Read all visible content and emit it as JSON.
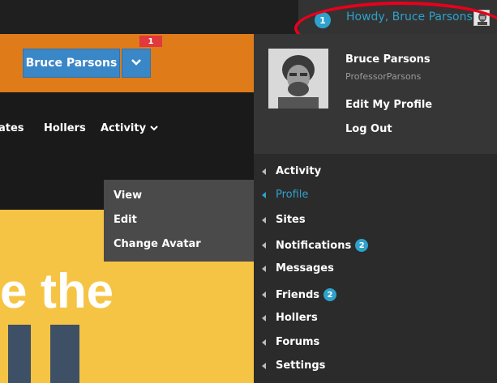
{
  "adminbar": {
    "count": "1",
    "howdy": "Howdy, Bruce Parsons"
  },
  "header": {
    "user_button": "Bruce Parsons",
    "notification_count": "1"
  },
  "nav": {
    "items": [
      "ates",
      "Hollers",
      "Activity"
    ]
  },
  "submenu": {
    "items": [
      "View",
      "Edit",
      "Change Avatar"
    ]
  },
  "hero": {
    "text": "e the"
  },
  "account": {
    "name": "Bruce Parsons",
    "username": "ProfessorParsons",
    "edit_profile": "Edit My Profile",
    "logout": "Log Out"
  },
  "menu": {
    "items": [
      {
        "label": "Activity"
      },
      {
        "label": "Profile"
      },
      {
        "label": "Sites"
      },
      {
        "label": "Notifications",
        "badge": "2"
      },
      {
        "label": "Messages"
      },
      {
        "label": "Friends",
        "badge": "2"
      },
      {
        "label": "Hollers"
      },
      {
        "label": "Forums"
      },
      {
        "label": "Settings"
      }
    ]
  },
  "colors": {
    "accent": "#2ea2cc",
    "orange": "#e07b19",
    "yellow": "#f6c445",
    "highlight": "#e8001c"
  }
}
